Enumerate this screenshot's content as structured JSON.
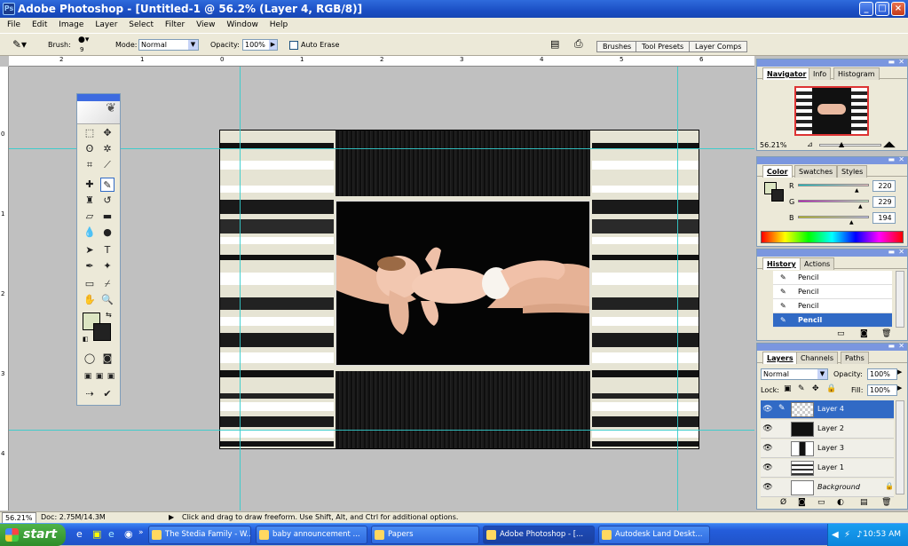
{
  "window": {
    "title": "Adobe Photoshop - [Untitled-1 @ 56.2% (Layer 4, RGB/8)]",
    "min": "_",
    "max": "□",
    "close": "×"
  },
  "menu": [
    "File",
    "Edit",
    "Image",
    "Layer",
    "Select",
    "Filter",
    "View",
    "Window",
    "Help"
  ],
  "options": {
    "brush_label": "Brush:",
    "brush_size": "9",
    "mode_label": "Mode:",
    "mode_value": "Normal",
    "opacity_label": "Opacity:",
    "opacity_value": "100%",
    "auto_erase": "Auto Erase",
    "well_tabs": [
      "Brushes",
      "Tool Presets",
      "Layer Comps"
    ]
  },
  "ruler": {
    "h": [
      "2",
      "1",
      "0",
      "1",
      "2",
      "3",
      "4",
      "5",
      "6"
    ],
    "v": [
      "0",
      "1",
      "2",
      "3",
      "4"
    ]
  },
  "navigator": {
    "tabs": [
      "Navigator",
      "Info",
      "Histogram"
    ],
    "zoom": "56.21%"
  },
  "color": {
    "tabs": [
      "Color",
      "Swatches",
      "Styles"
    ],
    "r_label": "R",
    "g_label": "G",
    "b_label": "B",
    "r": "220",
    "g": "229",
    "b": "194",
    "fg": "#dce5c2"
  },
  "history": {
    "tabs": [
      "History",
      "Actions"
    ],
    "items": [
      "Pencil",
      "Pencil",
      "Pencil",
      "Pencil"
    ]
  },
  "layers": {
    "tabs": [
      "Layers",
      "Channels",
      "Paths"
    ],
    "mode": "Normal",
    "opacity_label": "Opacity:",
    "opacity": "100%",
    "lock_label": "Lock:",
    "fill_label": "Fill:",
    "fill": "100%",
    "items": [
      "Layer 4",
      "Layer 2",
      "Layer 3",
      "Layer 1",
      "Background"
    ]
  },
  "status": {
    "zoom": "56.21%",
    "doc": "Doc: 2.75M/14.3M",
    "hint": "Click and drag to draw freeform.  Use Shift, Alt, and Ctrl for additional options."
  },
  "taskbar": {
    "start": "start",
    "items": [
      "The Stedia Family - W...",
      "baby announcement ...",
      "Papers",
      "Adobe Photoshop - [...",
      "Autodesk Land Deskt..."
    ],
    "clock": "10:53 AM"
  }
}
